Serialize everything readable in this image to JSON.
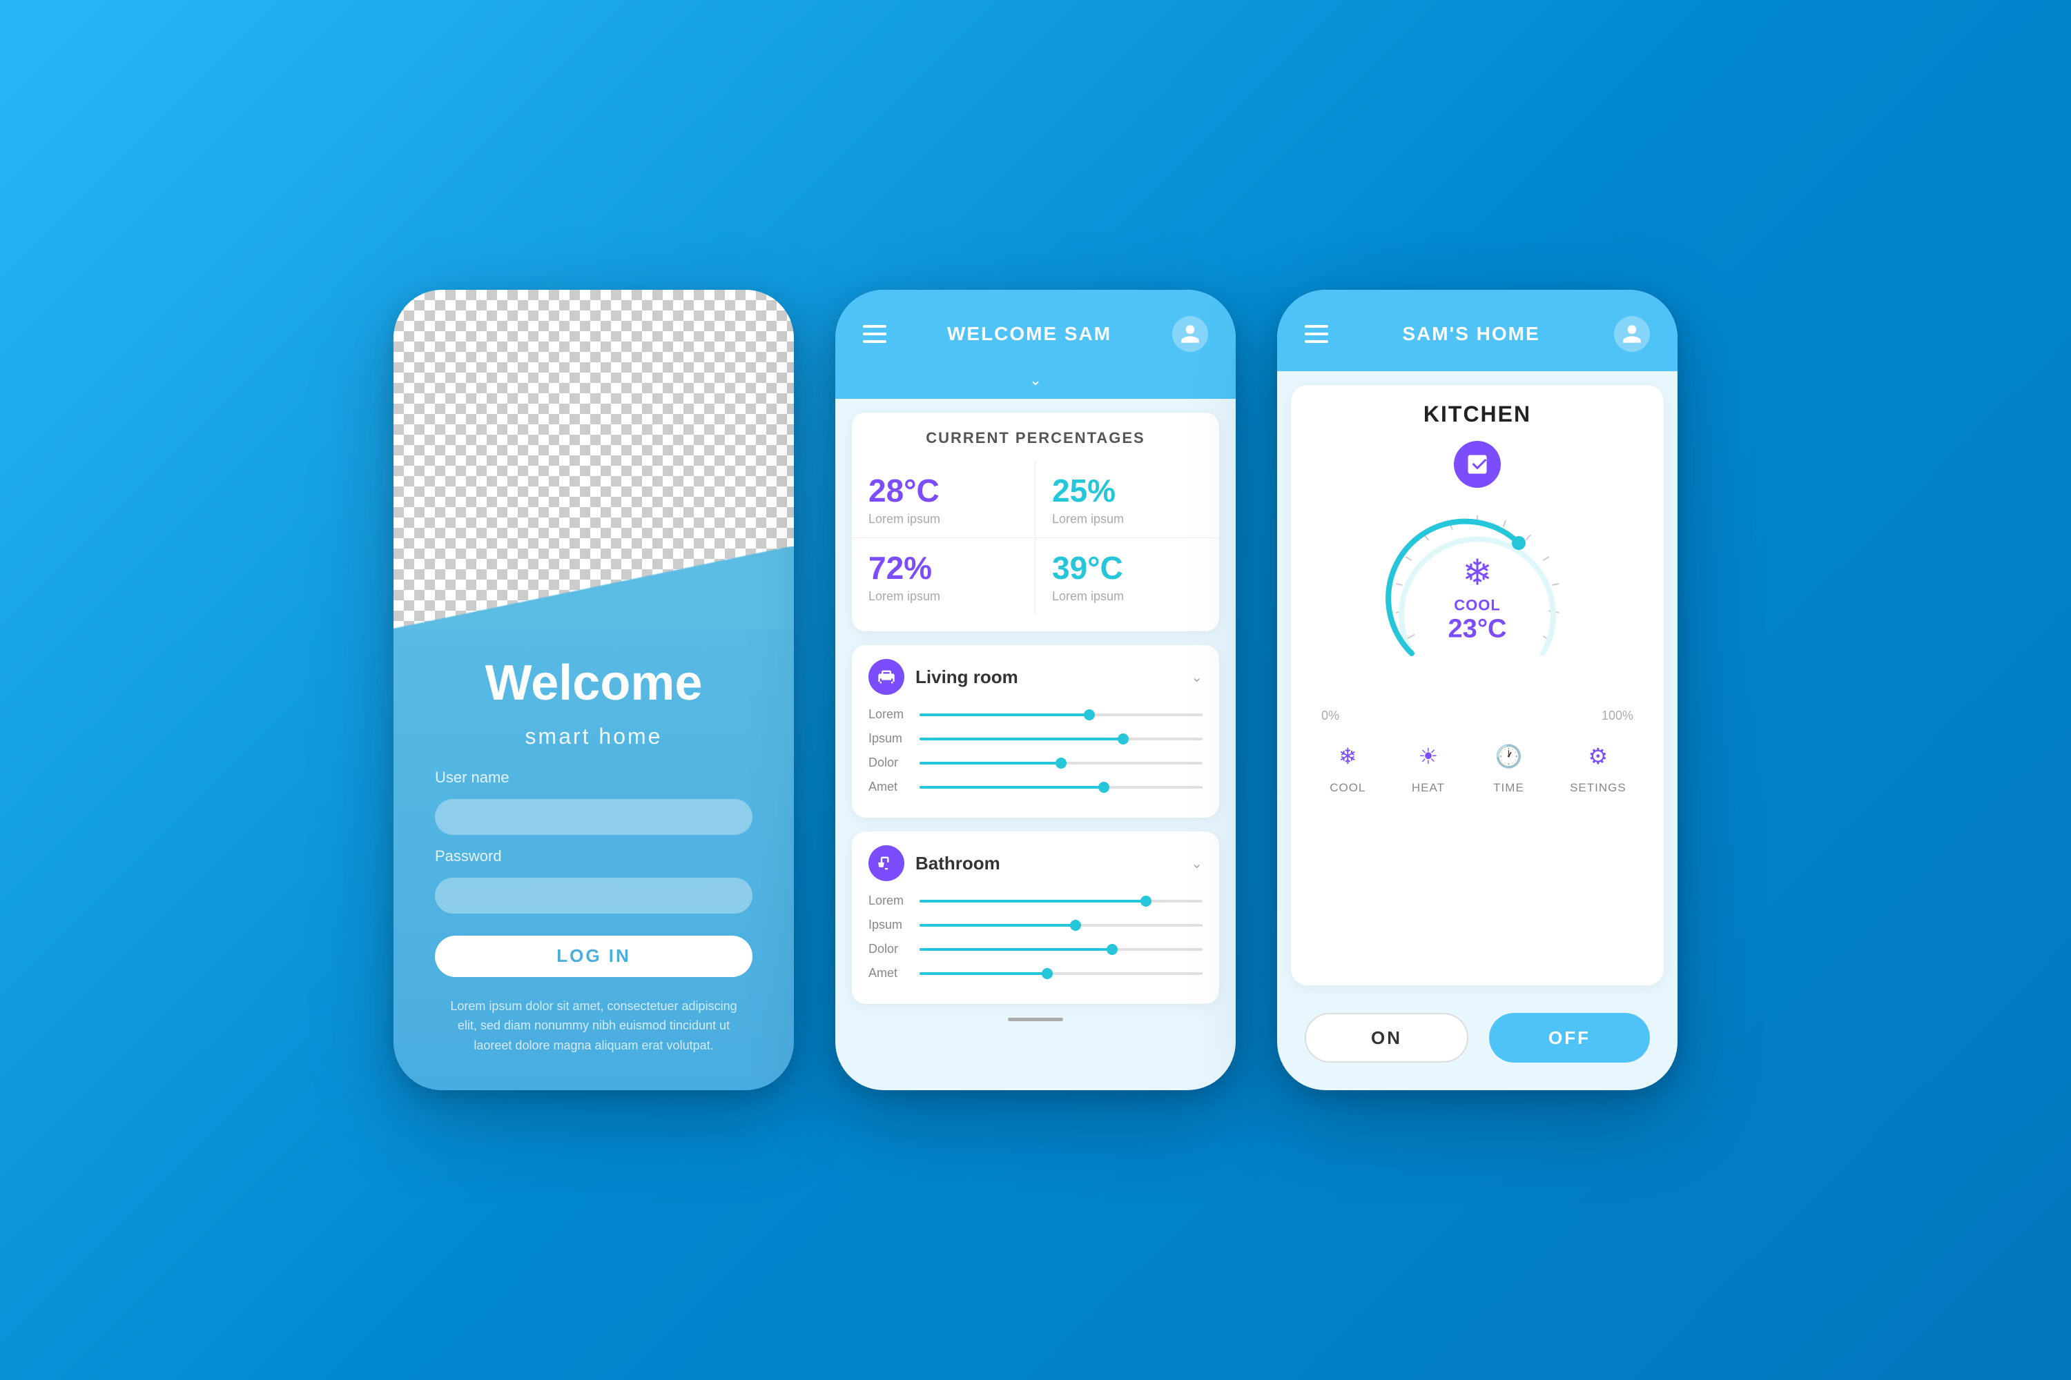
{
  "background": "#29b6f6",
  "phone1": {
    "welcome": "Welcome",
    "subtitle": "smart home",
    "username_label": "User name",
    "password_label": "Password",
    "login_button": "LOG IN",
    "footer_text": "Lorem ipsum dolor sit amet, consectetuer adipiscing elit, sed diam nonummy nibh euismod tincidunt ut laoreet dolore magna aliquam erat volutpat."
  },
  "phone2": {
    "header_title": "WELCOME SAM",
    "stats_title": "CURRENT PERCENTAGES",
    "stats": [
      {
        "value": "28°C",
        "label": "Lorem ipsum",
        "color": "purple"
      },
      {
        "value": "25%",
        "label": "Lorem ipsum",
        "color": "blue"
      },
      {
        "value": "72%",
        "label": "Lorem ipsum",
        "color": "purple"
      },
      {
        "value": "39°C",
        "label": "Lorem ipsum",
        "color": "blue"
      }
    ],
    "rooms": [
      {
        "name": "Living room",
        "sliders": [
          {
            "label": "Lorem",
            "fill": 60
          },
          {
            "label": "Ipsum",
            "fill": 72
          },
          {
            "label": "Dolor",
            "fill": 50
          },
          {
            "label": "Amet",
            "fill": 65
          }
        ]
      },
      {
        "name": "Bathroom",
        "sliders": [
          {
            "label": "Lorem",
            "fill": 80
          },
          {
            "label": "Ipsum",
            "fill": 55
          },
          {
            "label": "Dolor",
            "fill": 68
          },
          {
            "label": "Amet",
            "fill": 45
          }
        ]
      }
    ]
  },
  "phone3": {
    "header_title": "SAM'S HOME",
    "room": "KITCHEN",
    "mode": "COOL",
    "temperature": "23°C",
    "label_min": "0%",
    "label_max": "100%",
    "controls": [
      {
        "name": "cool",
        "label": "COOL",
        "icon": "❄"
      },
      {
        "name": "heat",
        "label": "HEAT",
        "icon": "☀"
      },
      {
        "name": "time",
        "label": "TIME",
        "icon": "🕐"
      },
      {
        "name": "settings",
        "label": "SETINGS",
        "icon": "⚙"
      }
    ],
    "btn_on": "ON",
    "btn_off": "OFF"
  }
}
